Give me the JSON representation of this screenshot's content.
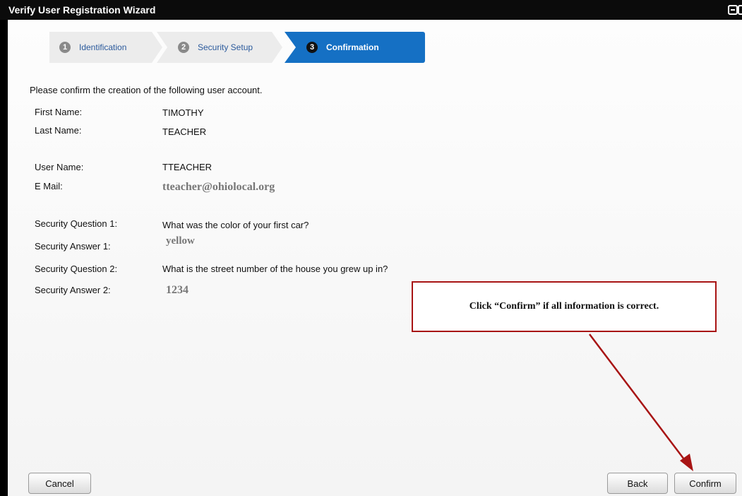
{
  "window": {
    "title": "Verify User Registration Wizard"
  },
  "steps": [
    {
      "number": "1",
      "label": "Identification"
    },
    {
      "number": "2",
      "label": "Security Setup"
    },
    {
      "number": "3",
      "label": "Confirmation"
    }
  ],
  "intro": "Please confirm the creation of the following user account.",
  "fields": {
    "first_name": {
      "label": "First Name:",
      "value": "TIMOTHY"
    },
    "last_name": {
      "label": "Last Name:",
      "value": "TEACHER"
    },
    "user_name": {
      "label": "User Name:",
      "value": "TTEACHER"
    },
    "email": {
      "label": "E Mail:",
      "value": "tteacher@ohiolocal.org"
    },
    "question1": {
      "label": "Security Question 1:",
      "value": "What was the color of your first car?"
    },
    "answer1": {
      "label": "Security Answer 1:",
      "value": "yellow"
    },
    "question2": {
      "label": "Security Question 2:",
      "value": "What is the street number of the house you grew up in?"
    },
    "answer2": {
      "label": "Security Answer 2:",
      "value": "1234"
    }
  },
  "callout": {
    "text": "Click “Confirm” if all information is correct."
  },
  "buttons": {
    "cancel": "Cancel",
    "back": "Back",
    "confirm": "Confirm"
  },
  "colors": {
    "active_step": "#1570c4",
    "callout_border": "#a81414",
    "arrow": "#a81414"
  }
}
